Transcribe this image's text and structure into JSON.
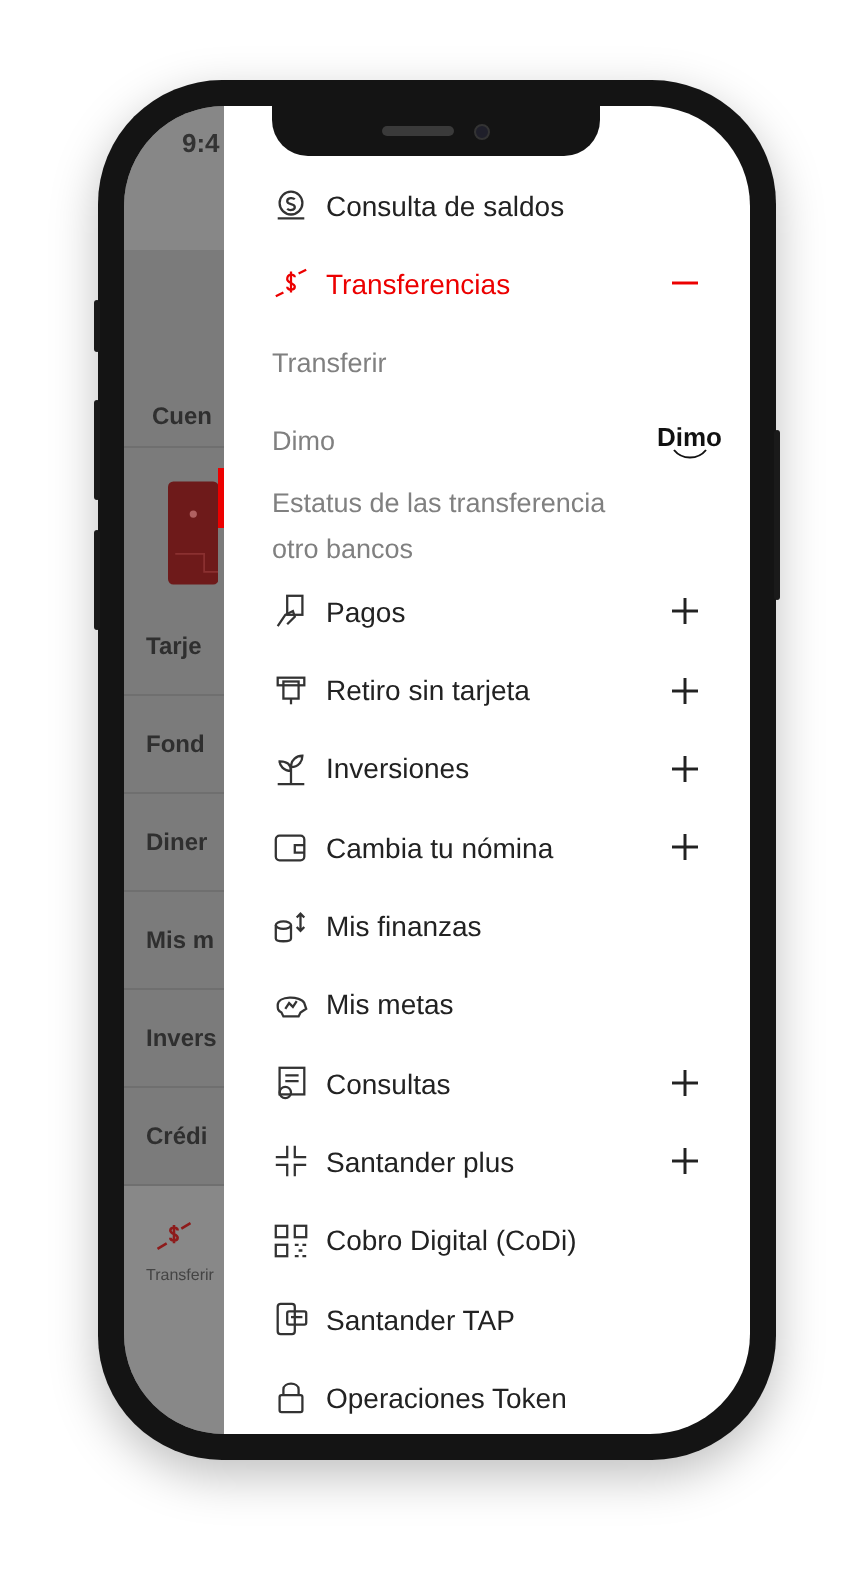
{
  "status_bar": {
    "time": "9:4"
  },
  "background": {
    "section_title": "Cuen",
    "rows": [
      "Tarje",
      "Fond",
      "Diner",
      "Mis m",
      "Invers",
      "Crédi"
    ],
    "bottom_nav": {
      "label": "Transferir"
    }
  },
  "menu": {
    "items": [
      {
        "kind": "link",
        "label": "Consulta de saldos"
      },
      {
        "kind": "group",
        "label": "Transferencias",
        "expanded": true,
        "children": [
          {
            "label": "Transferir"
          },
          {
            "label": "Dimo",
            "logo": "Dimo"
          },
          {
            "label": "Estatus de las transferencia otro bancos"
          }
        ]
      },
      {
        "kind": "group",
        "label": "Pagos",
        "expanded": false
      },
      {
        "kind": "group",
        "label": "Retiro sin tarjeta",
        "expanded": false
      },
      {
        "kind": "group",
        "label": "Inversiones",
        "expanded": false
      },
      {
        "kind": "group",
        "label": "Cambia tu nómina",
        "expanded": false
      },
      {
        "kind": "link",
        "label": "Mis finanzas"
      },
      {
        "kind": "link",
        "label": "Mis metas"
      },
      {
        "kind": "group",
        "label": "Consultas",
        "expanded": false
      },
      {
        "kind": "group",
        "label": "Santander plus",
        "expanded": false
      },
      {
        "kind": "link",
        "label": "Cobro Digital (CoDi)"
      },
      {
        "kind": "link",
        "label": "Santander TAP"
      },
      {
        "kind": "link",
        "label": "Operaciones Token"
      }
    ]
  }
}
